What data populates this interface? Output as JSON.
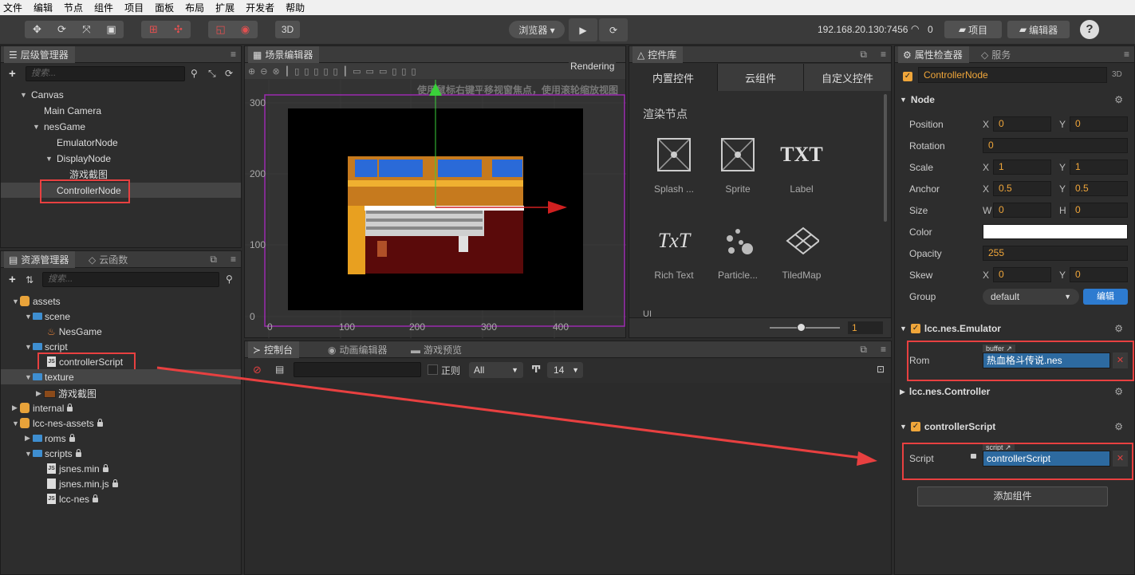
{
  "menu": [
    "文件",
    "编辑",
    "节点",
    "组件",
    "项目",
    "面板",
    "布局",
    "扩展",
    "开发者",
    "帮助"
  ],
  "toolbar": {
    "mode_3d": "3D",
    "browser": "浏览器 ▾",
    "ip": "192.168.20.130:7456",
    "wifi_count": "0",
    "project_btn": "项目",
    "editor_btn": "编辑器",
    "help": "?"
  },
  "hierarchy": {
    "tab": "层级管理器",
    "search_placeholder": "搜索...",
    "nodes": [
      "Canvas",
      "Main Camera",
      "nesGame",
      "EmulatorNode",
      "DisplayNode",
      "游戏截图",
      "ControllerNode"
    ]
  },
  "assets": {
    "tab": "资源管理器",
    "tab2": "云函数",
    "search_placeholder": "搜索...",
    "items": [
      "assets",
      "scene",
      "NesGame",
      "script",
      "controllerScript",
      "texture",
      "游戏截图",
      "internal",
      "lcc-nes-assets",
      "roms",
      "scripts",
      "jsnes.min",
      "jsnes.min.js",
      "lcc-nes"
    ]
  },
  "scene": {
    "tab": "场景编辑器",
    "rendering": "Rendering",
    "hint": "使用鼠标右键平移视窗焦点，使用滚轮缩放视图",
    "y_ticks": [
      "300",
      "200",
      "100",
      "0"
    ],
    "x_ticks": [
      "0",
      "100",
      "200",
      "300",
      "400"
    ]
  },
  "library": {
    "tab": "控件库",
    "tabs": [
      "内置控件",
      "云组件",
      "自定义控件"
    ],
    "section": "渲染节点",
    "items": [
      "Splash ...",
      "Sprite",
      "Label",
      "Rich Text",
      "Particle...",
      "TiledMap"
    ],
    "label_txt": "TXT",
    "richtext_txt": "TxT",
    "partial": "UI",
    "zoom_value": "1"
  },
  "console": {
    "tabs": [
      "控制台",
      "动画编辑器",
      "游戏预览"
    ],
    "regex": "正则",
    "level": "All",
    "font_size": "14"
  },
  "inspector": {
    "tab": "属性检查器",
    "tab2": "服务",
    "node_name": "ControllerNode",
    "mode": "3D",
    "node_section": "Node",
    "props": {
      "position": {
        "label": "Position",
        "x": "0",
        "y": "0"
      },
      "rotation": {
        "label": "Rotation",
        "v": "0"
      },
      "scale": {
        "label": "Scale",
        "x": "1",
        "y": "1"
      },
      "anchor": {
        "label": "Anchor",
        "x": "0.5",
        "y": "0.5"
      },
      "size": {
        "label": "Size",
        "w": "0",
        "h": "0"
      },
      "color": {
        "label": "Color",
        "value": "#ffffff"
      },
      "opacity": {
        "label": "Opacity",
        "v": "255"
      },
      "skew": {
        "label": "Skew",
        "x": "0",
        "y": "0"
      },
      "group": {
        "label": "Group",
        "v": "default",
        "edit": "编辑"
      }
    },
    "xy_labels": {
      "x": "X",
      "y": "Y",
      "w": "W",
      "h": "H"
    },
    "emulator": {
      "title": "lcc.nes.Emulator",
      "rom_label": "Rom",
      "rom_type": "buffer",
      "rom_value": "热血格斗传说.nes"
    },
    "controller": {
      "title": "lcc.nes.Controller"
    },
    "script_comp": {
      "title": "controllerScript",
      "label": "Script",
      "type": "script",
      "value": "controllerScript"
    },
    "add_component": "添加组件"
  }
}
